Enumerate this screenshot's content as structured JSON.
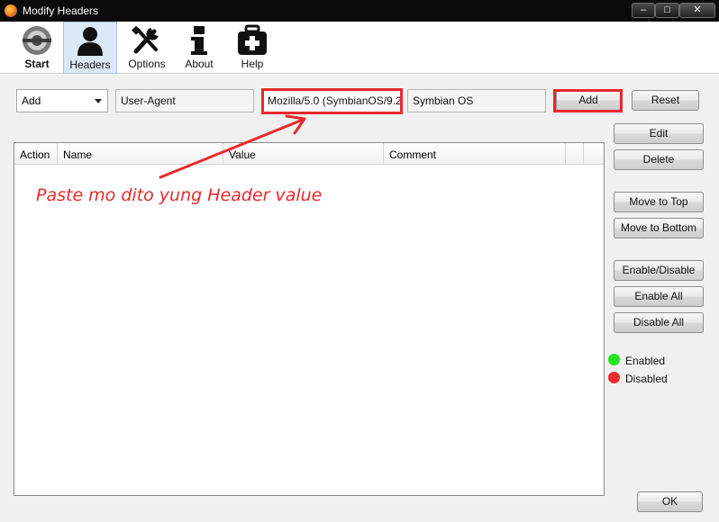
{
  "window": {
    "title": "Modify Headers",
    "controls": {
      "minimize": "‒",
      "maximize": "□",
      "close": "✕"
    }
  },
  "toolbar": {
    "items": [
      {
        "label": "Start",
        "icon": "start-icon",
        "selected": false
      },
      {
        "label": "Headers",
        "icon": "headers-person-icon",
        "selected": true
      },
      {
        "label": "Options",
        "icon": "wrench-screwdriver-icon",
        "selected": false
      },
      {
        "label": "About",
        "icon": "info-icon",
        "selected": false
      },
      {
        "label": "Help",
        "icon": "first-aid-kit-icon",
        "selected": false
      }
    ]
  },
  "form": {
    "action_select": "Add",
    "header_name": "User-Agent",
    "header_value": "Mozilla/5.0 (SymbianOS/9.2",
    "comment": "Symbian OS",
    "add_label": "Add",
    "reset_label": "Reset"
  },
  "table": {
    "columns": [
      "Action",
      "Name",
      "Value",
      "Comment"
    ],
    "rows": []
  },
  "side_buttons": {
    "edit": "Edit",
    "delete": "Delete",
    "move_top": "Move to Top",
    "move_bottom": "Move to Bottom",
    "enable_disable": "Enable/Disable",
    "enable_all": "Enable All",
    "disable_all": "Disable All"
  },
  "legend": {
    "enabled": {
      "label": "Enabled",
      "color": "#22e51f"
    },
    "disabled": {
      "label": "Disabled",
      "color": "#ef2b2b"
    }
  },
  "ok_label": "OK",
  "annotation": {
    "text": "Paste mo dito yung Header value",
    "color": "#e8292a"
  }
}
